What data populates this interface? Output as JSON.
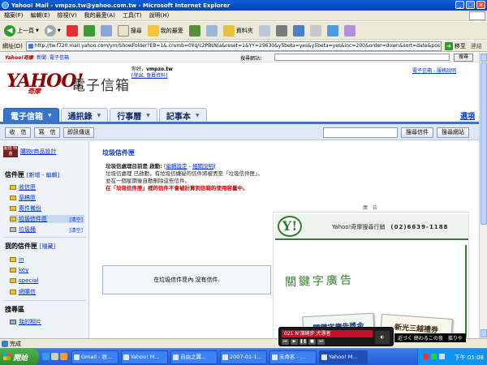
{
  "window": {
    "title": "Yahoo! Mail - vmpzo.tw@yahoo.com.tw - Microsoft Internet Explorer",
    "menu": [
      "檔案(F)",
      "編輯(E)",
      "檢視(V)",
      "我的最愛(A)",
      "工具(T)",
      "說明(H)"
    ]
  },
  "toolbar": {
    "back_label": "上一頁",
    "search_label": "搜尋",
    "favorites_label": "我的最愛",
    "folders_label": "資料夾"
  },
  "address": {
    "label": "網址(D)",
    "url": "http://tw.f720.mail.yahoo.com/ym/ShowFolder?EB=1&.crumb=0Yq/c2PBsNIa&reset=1&YY=29630&y5beta=yes&y5beta=yes&inc=200&order=down&sort=date&pos=-1&view",
    "go_label": "移至",
    "links_label": "連結"
  },
  "topstrip": {
    "links": [
      "Yahoo!奇摩",
      "新聞",
      "電子信箱"
    ],
    "search_label": "搜尋網站：",
    "search_button": "搜尋"
  },
  "header": {
    "logo": "YAHOO!",
    "logo_sub": "奇摩",
    "service": "電子信箱",
    "greeting": "你好，",
    "user": "vmpzo.tw",
    "signout": "[登出, 會員資料]",
    "right_links": "電子信箱 - 服務說明"
  },
  "tabs": [
    {
      "label": "電子信箱",
      "active": true
    },
    {
      "label": "通訊錄",
      "active": false
    },
    {
      "label": "行事曆",
      "active": false
    },
    {
      "label": "記事本",
      "active": false
    }
  ],
  "tab_options": "選項",
  "actions": {
    "receive": "收　信",
    "compose": "寫　信",
    "im": "即訊傳送",
    "search_mail": "搜尋信件",
    "search_web": "搜尋網站"
  },
  "sidebar": {
    "promo": "購物/商品設計",
    "promo_badge": "超值 特惠",
    "folders_header": "信件匣",
    "folders_links": "[新增 - 編輯]",
    "folders": [
      {
        "name": "收信匣",
        "selected": false,
        "clear": ""
      },
      {
        "name": "草稿匣",
        "selected": false,
        "clear": ""
      },
      {
        "name": "寄件備份",
        "selected": false,
        "clear": ""
      },
      {
        "name": "垃圾信件匣",
        "selected": true,
        "clear": "[清空]"
      },
      {
        "name": "垃圾桶",
        "selected": false,
        "clear": "[清空]"
      }
    ],
    "my_folders_header": "我的信件匣",
    "my_folders_links": "[隱藏]",
    "my_folders": [
      "in",
      "key",
      "special",
      "網購信"
    ],
    "search_header": "搜尋區",
    "search_item": "我的相片"
  },
  "main": {
    "title": "垃圾信件匣",
    "note_bold": "垃圾信處理目前是 啟動:",
    "note_link1": "編輯設定",
    "note_link2": "相關說明",
    "note_body": "垃圾信處理 已啟動，有垃圾信嫌疑的信件將被丟至「垃圾信件匣」，並在一個星期後自動刪除這些信件。",
    "note_warn": "在「垃圾信件匣」裡的信件不會被計算到信箱的使用容量中。",
    "empty_text": "在垃圾信件匣內 沒有信件."
  },
  "ad": {
    "label": "廣　告",
    "logo": "Y!",
    "phone_text": "Yahoo!奇摩搜尋行銷",
    "phone": "(02)6639-1188",
    "handwriting": "關鍵字廣告",
    "card1": "關鍵字廣告獎金",
    "card2": "新光三越禮券"
  },
  "player": {
    "track": "021 N'濱崎步 犬漂者",
    "lyrics": "近づく 終わるこの夜　揺りや"
  },
  "status": "完成",
  "taskbar": {
    "start": "開始",
    "tasks": [
      "Gmail - 收...",
      "Yahoo! M...",
      "自由之翼...",
      "2007-01-1...",
      "未命名 - ...",
      "Yahoo! M..."
    ],
    "clock": "下午 05:08"
  }
}
